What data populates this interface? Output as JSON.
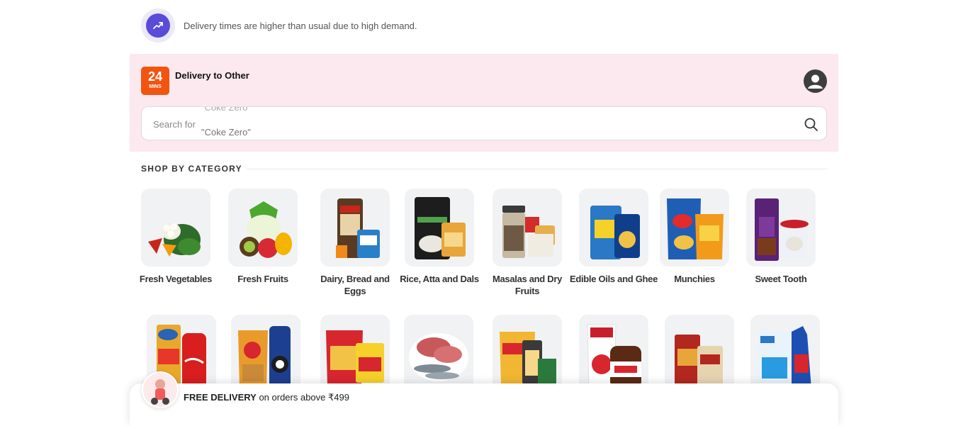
{
  "notice": {
    "text": "Delivery times are higher than usual due to high demand.",
    "icon": "trending-up-icon"
  },
  "header": {
    "badge_number": "24",
    "badge_unit": "MINS",
    "delivery_label": "Delivery to Other",
    "profile_icon": "user-circle-icon"
  },
  "search": {
    "prefix": "Search for",
    "ghost_text": "\"Coke Zero\"",
    "current_term": "\"Coke Zero\"",
    "icon": "search-icon"
  },
  "section": {
    "title": "SHOP BY CATEGORY"
  },
  "categories_row1": [
    {
      "label": "Fresh Vegetables"
    },
    {
      "label": "Fresh Fruits"
    },
    {
      "label": "Dairy, Bread and Eggs"
    },
    {
      "label": "Rice, Atta and Dals"
    },
    {
      "label": "Masalas and Dry Fruits"
    },
    {
      "label": "Edible Oils and Ghee"
    },
    {
      "label": "Munchies"
    },
    {
      "label": "Sweet Tooth"
    }
  ],
  "footer": {
    "bold": "FREE DELIVERY",
    "rest": " on orders above ₹499"
  },
  "colors": {
    "accent_purple": "#5b4bd9",
    "badge_orange": "#f1550f",
    "header_pink": "#fce8ef"
  }
}
